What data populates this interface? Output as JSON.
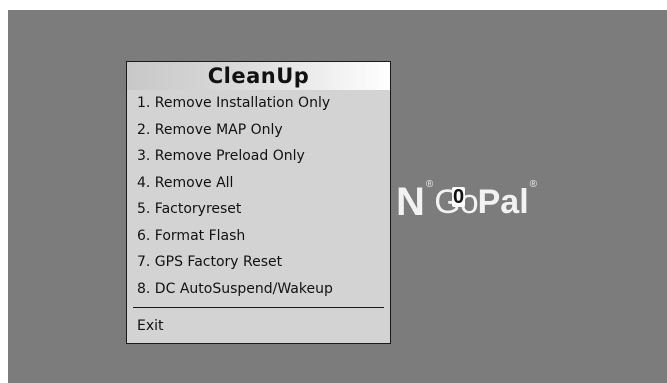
{
  "background_brand": {
    "left_fragment": "N",
    "go": "Go",
    "pal": "Pal",
    "registered": "®"
  },
  "cursor_glyph": "0",
  "dialog": {
    "title": "CleanUp",
    "items": [
      {
        "label": "1. Remove Installation Only"
      },
      {
        "label": "2. Remove MAP Only"
      },
      {
        "label": "3. Remove Preload Only"
      },
      {
        "label": "4. Remove All"
      },
      {
        "label": "5. Factoryreset"
      },
      {
        "label": "6. Format Flash"
      },
      {
        "label": "7. GPS Factory Reset"
      },
      {
        "label": "8. DC AutoSuspend/Wakeup"
      }
    ],
    "exit_label": "Exit"
  },
  "colors": {
    "screen_background": "#7c7c7c",
    "dialog_background": "#d3d3d3",
    "brand_text": "#f2f2f2"
  }
}
